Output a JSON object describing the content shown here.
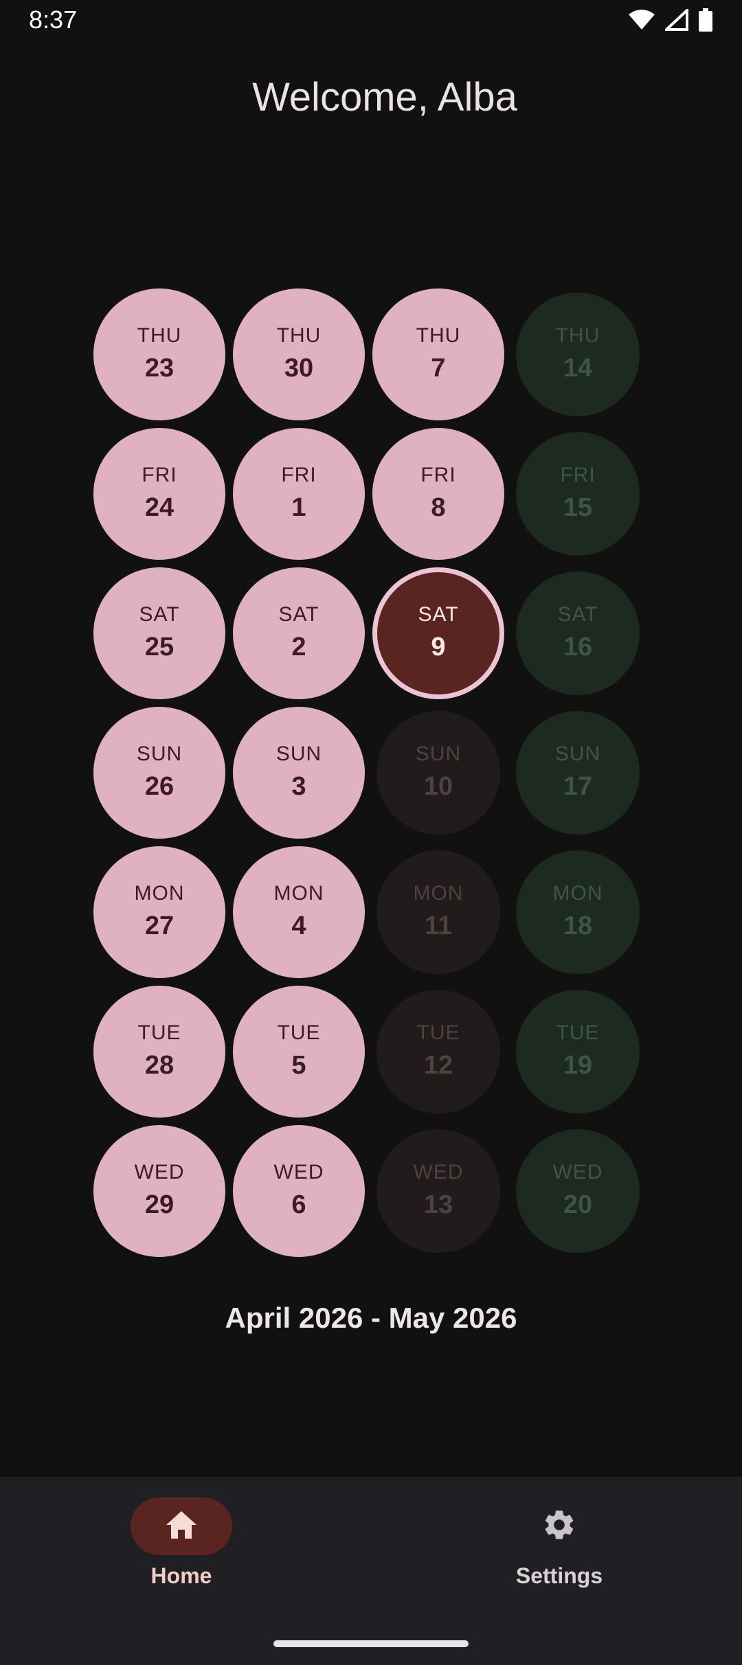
{
  "status_bar": {
    "time": "8:37"
  },
  "header": {
    "welcome": "Welcome, Alba"
  },
  "calendar": {
    "columns": [
      [
        {
          "weekday": "THU",
          "day": "23",
          "state": "past"
        },
        {
          "weekday": "FRI",
          "day": "24",
          "state": "past"
        },
        {
          "weekday": "SAT",
          "day": "25",
          "state": "past"
        },
        {
          "weekday": "SUN",
          "day": "26",
          "state": "past"
        },
        {
          "weekday": "MON",
          "day": "27",
          "state": "past"
        },
        {
          "weekday": "TUE",
          "day": "28",
          "state": "past"
        },
        {
          "weekday": "WED",
          "day": "29",
          "state": "past"
        }
      ],
      [
        {
          "weekday": "THU",
          "day": "30",
          "state": "past"
        },
        {
          "weekday": "FRI",
          "day": "1",
          "state": "past"
        },
        {
          "weekday": "SAT",
          "day": "2",
          "state": "past"
        },
        {
          "weekday": "SUN",
          "day": "3",
          "state": "past"
        },
        {
          "weekday": "MON",
          "day": "4",
          "state": "past"
        },
        {
          "weekday": "TUE",
          "day": "5",
          "state": "past"
        },
        {
          "weekday": "WED",
          "day": "6",
          "state": "past"
        }
      ],
      [
        {
          "weekday": "THU",
          "day": "7",
          "state": "past"
        },
        {
          "weekday": "FRI",
          "day": "8",
          "state": "past"
        },
        {
          "weekday": "SAT",
          "day": "9",
          "state": "today"
        },
        {
          "weekday": "SUN",
          "day": "10",
          "state": "future"
        },
        {
          "weekday": "MON",
          "day": "11",
          "state": "future"
        },
        {
          "weekday": "TUE",
          "day": "12",
          "state": "future"
        },
        {
          "weekday": "WED",
          "day": "13",
          "state": "future"
        }
      ],
      [
        {
          "weekday": "THU",
          "day": "14",
          "state": "next"
        },
        {
          "weekday": "FRI",
          "day": "15",
          "state": "next"
        },
        {
          "weekday": "SAT",
          "day": "16",
          "state": "next"
        },
        {
          "weekday": "SUN",
          "day": "17",
          "state": "next"
        },
        {
          "weekday": "MON",
          "day": "18",
          "state": "next"
        },
        {
          "weekday": "TUE",
          "day": "19",
          "state": "next"
        },
        {
          "weekday": "WED",
          "day": "20",
          "state": "next"
        }
      ]
    ],
    "range_label": "April 2026 - May 2026"
  },
  "colors": {
    "background": "#121112",
    "past_circle": "#e0b0c3",
    "today_circle": "#5a2520",
    "future_circle": "#221b1b",
    "next_circle": "#1c2a20",
    "nav_background": "#201f23"
  },
  "bottom_nav": {
    "items": [
      {
        "label": "Home",
        "icon": "home-icon",
        "active": true
      },
      {
        "label": "Settings",
        "icon": "gear-icon",
        "active": false
      }
    ]
  }
}
